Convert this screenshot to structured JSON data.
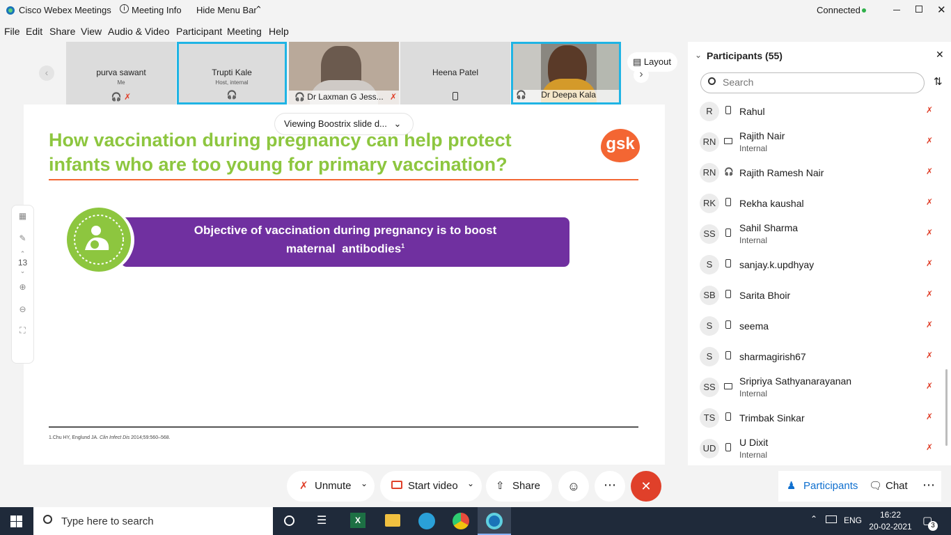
{
  "titlebar": {
    "app_title": "Cisco Webex Meetings",
    "meeting_info": "Meeting Info",
    "hide_menu": "Hide Menu Bar",
    "status": "Connected"
  },
  "menu": [
    "File",
    "Edit",
    "Share",
    "View",
    "Audio & Video",
    "Participant",
    "Meeting",
    "Help"
  ],
  "videos": [
    {
      "name": "purva sawant",
      "sub": "Me"
    },
    {
      "name": "Trupti Kale",
      "sub": "Host, internal"
    },
    {
      "name": "Dr Laxman G Jess..."
    },
    {
      "name": "Heena Patel"
    },
    {
      "name": "Dr Deepa Kala"
    }
  ],
  "layout_label": "Layout",
  "viewing_label": "Viewing Boostrix slide d...",
  "slide": {
    "title_line1": "How vaccination during pregnancy can help protect",
    "title_line2": "infants who are too young for primary vaccination?",
    "logo": "gsk",
    "objective_line1": "Objective of vaccination during pregnancy is to boost",
    "objective_line2": "maternal  antibodies",
    "objective_sup": "1",
    "footnote_authors": "1.Chu HY, Englund JA. ",
    "footnote_journal": "Clin Infect Dis",
    "footnote_ref": " 2014;59:560–568.",
    "page_number": "13"
  },
  "panel": {
    "title": "Participants (55)",
    "search_placeholder": "Search",
    "participants": [
      {
        "initials": "R",
        "name": "Rahul",
        "sub": ""
      },
      {
        "initials": "RN",
        "name": "Rajith Nair",
        "sub": "Internal"
      },
      {
        "initials": "RN",
        "name": "Rajith Ramesh Nair",
        "sub": ""
      },
      {
        "initials": "RK",
        "name": "Rekha kaushal",
        "sub": ""
      },
      {
        "initials": "SS",
        "name": "Sahil Sharma",
        "sub": "Internal"
      },
      {
        "initials": "S",
        "name": "sanjay.k.updhyay",
        "sub": ""
      },
      {
        "initials": "SB",
        "name": "Sarita Bhoir",
        "sub": ""
      },
      {
        "initials": "S",
        "name": "seema",
        "sub": ""
      },
      {
        "initials": "S",
        "name": "sharmagirish67",
        "sub": ""
      },
      {
        "initials": "SS",
        "name": "Sripriya Sathyanarayanan",
        "sub": "Internal"
      },
      {
        "initials": "TS",
        "name": "Trimbak Sinkar",
        "sub": ""
      },
      {
        "initials": "UD",
        "name": "U Dixit",
        "sub": "Internal"
      }
    ]
  },
  "controls": {
    "unmute": "Unmute",
    "start_video": "Start video",
    "share": "Share",
    "participants": "Participants",
    "chat": "Chat"
  },
  "taskbar": {
    "search_placeholder": "Type here to search",
    "lang": "ENG",
    "time": "16:22",
    "date": "20-02-2021",
    "notifications": "3"
  },
  "colors": {
    "accent": "#1fb4e4",
    "slide_green": "#8dc63f",
    "slide_purple": "#7030a0",
    "gsk_orange": "#f36633",
    "leave_red": "#e0402a",
    "taskbar": "#1f2a3a"
  }
}
